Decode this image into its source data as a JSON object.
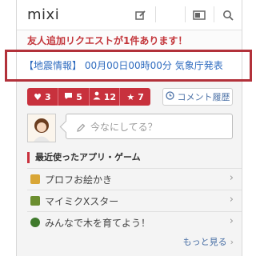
{
  "header": {
    "logo": "mixi",
    "icons": [
      "edit-icon",
      "inbox-icon",
      "search-icon"
    ]
  },
  "notice": {
    "text": "友人追加リクエストが1件あります！"
  },
  "quake": {
    "text": "【地震情報】 00月00日00時00分 気象庁発表"
  },
  "stats": [
    {
      "icon": "heart-icon",
      "count": "3"
    },
    {
      "icon": "comment-icon",
      "count": "5"
    },
    {
      "icon": "person-icon",
      "count": "12"
    },
    {
      "icon": "star-icon",
      "count": "7"
    }
  ],
  "comment_history": {
    "label": "コメント履歴"
  },
  "status": {
    "placeholder": "今なにしてる？"
  },
  "recent_apps": {
    "title": "最近使ったアプリ・ゲーム",
    "items": [
      {
        "label": "プロフお絵かき",
        "color": "#d9a636"
      },
      {
        "label": "マイミクXスター",
        "color": "#6b8e2f"
      },
      {
        "label": "みんなで木を育てよう！",
        "color": "#3f7a2c"
      }
    ]
  },
  "more": {
    "label": "もっと見る",
    "chevron": "›"
  },
  "colors": {
    "accent": "#c8313d",
    "link": "#4a70a6",
    "quake_border": "#b2313a"
  }
}
